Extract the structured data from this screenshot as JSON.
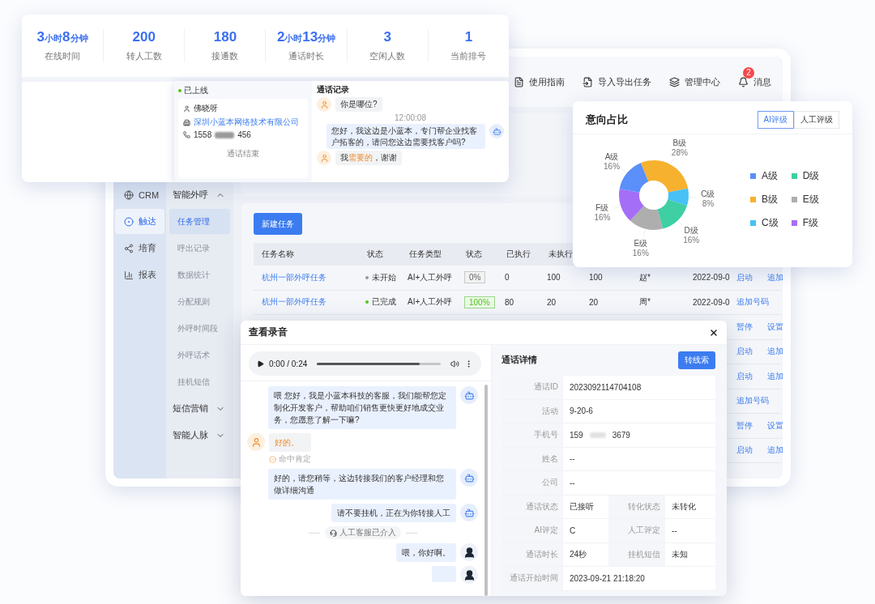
{
  "stats_card": {
    "stats": [
      {
        "parts": [
          {
            "text": "3",
            "kind": "num"
          },
          {
            "text": "小时",
            "kind": "unit"
          },
          {
            "text": "8",
            "kind": "num"
          },
          {
            "text": "分钟",
            "kind": "unit"
          }
        ],
        "label": "在线时间"
      },
      {
        "parts": [
          {
            "text": "200",
            "kind": "num"
          }
        ],
        "label": "转人工数"
      },
      {
        "parts": [
          {
            "text": "180",
            "kind": "num"
          }
        ],
        "label": "接通数"
      },
      {
        "parts": [
          {
            "text": "2",
            "kind": "num"
          },
          {
            "text": "小时",
            "kind": "unit"
          },
          {
            "text": "13",
            "kind": "num"
          },
          {
            "text": "分钟",
            "kind": "unit"
          }
        ],
        "label": "通话时长"
      },
      {
        "parts": [
          {
            "text": "3",
            "kind": "num"
          }
        ],
        "label": "空闲人数"
      },
      {
        "parts": [
          {
            "text": "1",
            "kind": "num"
          }
        ],
        "label": "当前排号"
      }
    ]
  },
  "call_card": {
    "status": "已上线",
    "online": true,
    "contact": {
      "name": "佛晓呀",
      "company": "深圳小蓝本网络技术有限公司",
      "phone": {
        "start": "1558",
        "end": "456"
      }
    },
    "call_state": "通话结束",
    "title": "通话记录",
    "messages": [
      {
        "kind": "customer",
        "parts": [
          {
            "text": "你是哪位?",
            "highlight": false
          }
        ]
      },
      {
        "kind": "time",
        "parts": [
          {
            "text": "12:00:08",
            "highlight": false
          }
        ]
      },
      {
        "kind": "bot",
        "parts": [
          {
            "text": "您好，我这边是小蓝本，专门帮企业找客户拓客的，请问您这边需要找客户吗?",
            "highlight": false
          }
        ]
      },
      {
        "kind": "customer",
        "parts": [
          {
            "text": "我",
            "highlight": false
          },
          {
            "text": "需要的",
            "highlight": true
          },
          {
            "text": "，谢谢",
            "highlight": false
          }
        ]
      }
    ]
  },
  "app": {
    "toolbar": [
      {
        "label": "使用指南"
      },
      {
        "label": "导入导出任务"
      },
      {
        "label": "管理中心"
      },
      {
        "label": "消息",
        "badge": "2"
      }
    ],
    "rail": [
      {
        "label": "CRM",
        "selected": false
      },
      {
        "label": "触达",
        "selected": true
      },
      {
        "label": "培育",
        "selected": false
      },
      {
        "label": "报表",
        "selected": false
      }
    ],
    "submenu": [
      {
        "kind": "group",
        "label": "智能外呼",
        "expanded": true
      },
      {
        "kind": "item",
        "label": "任务管理",
        "selected": true
      },
      {
        "kind": "item",
        "label": "呼出记录",
        "selected": false
      },
      {
        "kind": "item",
        "label": "数据统计",
        "selected": false
      },
      {
        "kind": "item",
        "label": "分配规则",
        "selected": false
      },
      {
        "kind": "item",
        "label": "外呼时间段",
        "selected": false
      },
      {
        "kind": "item",
        "label": "外呼话术",
        "selected": false
      },
      {
        "kind": "item",
        "label": "挂机短信",
        "selected": false
      },
      {
        "kind": "group",
        "label": "短信营销",
        "expanded": false
      },
      {
        "kind": "group",
        "label": "智能人脉",
        "expanded": false
      }
    ],
    "new_task_button": "新建任务",
    "table": {
      "columns": [
        "任务名称",
        "状态",
        "任务类型",
        "状态",
        "已执行",
        "未执行"
      ],
      "rows": [
        {
          "name": "杭州一部外呼任务",
          "status": "未开始",
          "color": "#9a9a9a",
          "type": "AI+人工外呼",
          "progress": "0%",
          "complete": false,
          "executed": "0",
          "pending": "100",
          "column_7": "100",
          "column_8": "赵*",
          "column_9": "2022-09-0",
          "actions": [
            "启动",
            "追加"
          ]
        },
        {
          "name": "杭州一部外呼任务",
          "status": "已完成",
          "color": "#52c41a",
          "type": "AI+人工外呼",
          "progress": "100%",
          "complete": true,
          "executed": "80",
          "pending": "20",
          "column_7": "20",
          "column_8": "周*",
          "column_9": "2022-09-0",
          "actions": [
            "追加号码"
          ]
        },
        {
          "actions": [
            "暂停",
            "设置"
          ]
        },
        {
          "actions": [
            "启动",
            "追加"
          ]
        },
        {
          "actions": [
            "启动",
            "追加"
          ]
        },
        {
          "actions": [
            "追加号码"
          ]
        },
        {
          "actions": [
            "暂停",
            "设置"
          ]
        },
        {
          "actions": [
            "启动",
            "追加"
          ]
        }
      ]
    }
  },
  "chart_card": {
    "title": "意向占比",
    "tabs": [
      {
        "label": "AI评级",
        "selected": true
      },
      {
        "label": "人工评级",
        "selected": false
      }
    ],
    "chart_data": {
      "type": "donut",
      "categories": [
        "A级",
        "B级",
        "C级",
        "D级",
        "E级",
        "F级"
      ],
      "values": [
        16,
        28,
        8,
        16,
        16,
        16
      ],
      "value_labels": [
        "16%",
        "28%",
        "8%",
        "16%",
        "16%",
        "16%"
      ]
    },
    "legend": [
      {
        "label": "A级",
        "color": "#5b8ff9"
      },
      {
        "label": "B级",
        "color": "#f6b12f"
      },
      {
        "label": "C级",
        "color": "#47c1f6"
      },
      {
        "label": "D级",
        "color": "#3ecfa3"
      },
      {
        "label": "E级",
        "color": "#aeaeae"
      },
      {
        "label": "F级",
        "color": "#a46ef7"
      }
    ]
  },
  "recording": {
    "title": "查看录音",
    "player": {
      "time": "0:00 / 0:24",
      "level": 0.83
    },
    "messages": [
      {
        "kind": "bot",
        "text": "喂 您好，我是小蓝本科技的客服，我们能帮您定制化开发客户，帮助咱们销售更快更好地成交业务，您愿意了解一下嘛?"
      },
      {
        "kind": "customer",
        "text": "好的。",
        "tag": "命中肯定"
      },
      {
        "kind": "bot",
        "text": "好的，请您稍等，这边转接我们的客户经理和您做详细沟通"
      },
      {
        "kind": "bot",
        "text": "请不要挂机，正在为你转接人工"
      },
      {
        "kind": "system",
        "text": "人工客服已介入"
      },
      {
        "kind": "agent",
        "text": "喂，你好啊。"
      },
      {
        "kind": "agent"
      }
    ],
    "details": {
      "title": "通话详情",
      "button": "转线索",
      "rows": [
        {
          "cells": [
            {
              "label": "通话ID",
              "value": "2023092114704108"
            }
          ]
        },
        {
          "cells": [
            {
              "label": "活动",
              "value": "9-20-6"
            }
          ]
        },
        {
          "cells": [
            {
              "label": "手机号",
              "masked": {
                "start": "159",
                "end": "3679"
              }
            }
          ]
        },
        {
          "cells": [
            {
              "label": "姓名",
              "value": "--"
            }
          ]
        },
        {
          "cells": [
            {
              "label": "公司",
              "value": "--"
            }
          ]
        },
        {
          "cells": [
            {
              "label": "通话状态",
              "value": "已接听"
            },
            {
              "label": "转化状态",
              "value": "未转化"
            }
          ]
        },
        {
          "cells": [
            {
              "label": "AI评定",
              "value": "C"
            },
            {
              "label": "人工评定",
              "value": "--"
            }
          ]
        },
        {
          "cells": [
            {
              "label": "通话时长",
              "value": "24秒"
            },
            {
              "label": "挂机短信",
              "value": "未知"
            }
          ]
        },
        {
          "cells": [
            {
              "label": "通话开始时间",
              "value": "2023-09-21 21:18:20"
            }
          ]
        }
      ]
    }
  }
}
